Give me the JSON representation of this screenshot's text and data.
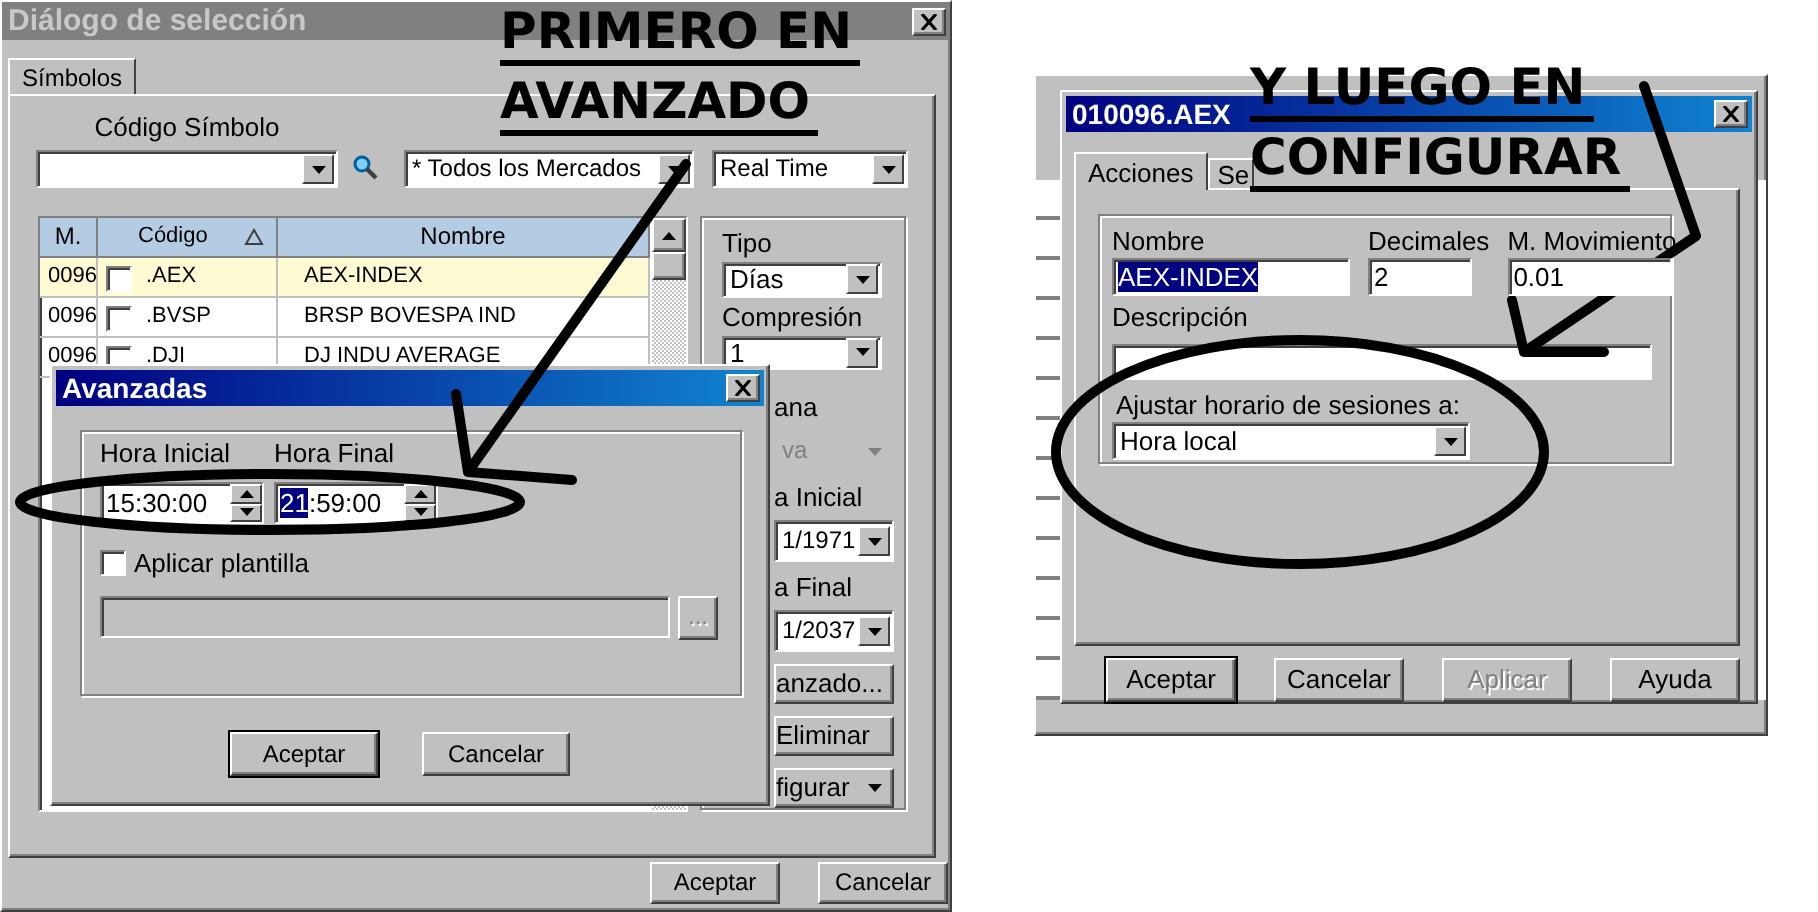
{
  "left_window": {
    "title": "Diálogo de selección",
    "tabs": [
      {
        "label": "Símbolos",
        "selected": true
      }
    ],
    "filters": [
      {
        "label": "Código Símbolo"
      },
      {
        "value": "* Todos los Mercados"
      },
      {
        "value": "Real Time"
      }
    ],
    "table": {
      "columns": [
        "M.",
        "Código",
        "Nombre"
      ],
      "rows": [
        {
          "cells": [
            "0096",
            ".AEX",
            "AEX-INDEX"
          ],
          "selected": true,
          "checked": false
        },
        {
          "cells": [
            "0096",
            ".BVSP",
            "BRSP BOVESPA IND"
          ],
          "selected": false,
          "checked": false
        },
        {
          "cells": [
            "0096",
            ".DJI",
            "DJ INDU AVERAGE"
          ],
          "selected": false,
          "checked": false
        }
      ]
    },
    "side_panel": [
      {
        "kind": "label",
        "text": "Tipo"
      },
      {
        "kind": "combo",
        "text": "Días",
        "disabled": false
      },
      {
        "kind": "label",
        "text": "Compresión"
      },
      {
        "kind": "combo",
        "text": "1",
        "disabled": false
      }
    ],
    "side_panel_partial": [
      {
        "kind": "label",
        "text": "ana"
      },
      {
        "kind": "combo",
        "text": "va",
        "disabled": true
      },
      {
        "kind": "label",
        "text": "a Inicial"
      },
      {
        "kind": "combo",
        "text": "1/1971",
        "disabled": false
      },
      {
        "kind": "label",
        "text": "a Final"
      },
      {
        "kind": "combo",
        "text": "1/2037",
        "disabled": false
      },
      {
        "kind": "button",
        "text": "anzado..."
      },
      {
        "kind": "button",
        "text": "Eliminar"
      },
      {
        "kind": "menu_button",
        "text": "figurar"
      }
    ],
    "buttons": [
      "Aceptar",
      "Cancelar"
    ]
  },
  "advanced_dialog": {
    "title": "Avanzadas",
    "time_fields": [
      {
        "label": "Hora Inicial",
        "value": "15:30:00"
      },
      {
        "label": "Hora Final",
        "selected_text": "21",
        "value": ":59:00"
      }
    ],
    "checkbox": {
      "label": "Aplicar plantilla",
      "checked": false
    },
    "browse_button": "...",
    "buttons": [
      {
        "label": "Aceptar",
        "default": true
      },
      {
        "label": "Cancelar",
        "default": false
      }
    ]
  },
  "config_dialog": {
    "title": "010096.AEX",
    "tabs": [
      {
        "label": "Acciones",
        "selected": true
      },
      {
        "label": "Se",
        "selected": false
      }
    ],
    "fields": [
      {
        "label": "Nombre",
        "value": "AEX-INDEX",
        "selected": true
      },
      {
        "label": "Decimales",
        "value": "2",
        "selected": false
      },
      {
        "label": "M. Movimiento",
        "value": "0.01",
        "selected": false
      }
    ],
    "description": {
      "label": "Descripción"
    },
    "session": {
      "label": "Ajustar horario de sesiones a:",
      "value": "Hora local"
    },
    "buttons": [
      {
        "label": "Aceptar",
        "default": true,
        "disabled": false
      },
      {
        "label": "Cancelar",
        "default": false,
        "disabled": false
      },
      {
        "label": "Aplicar",
        "default": false,
        "disabled": true
      },
      {
        "label": "Ayuda",
        "default": false,
        "disabled": false
      }
    ]
  },
  "annotations": [
    {
      "lines": [
        "PRIMERO EN",
        "AVANZADO"
      ]
    },
    {
      "lines": [
        "Y LUEGO EN",
        "CONFIGURAR"
      ]
    }
  ]
}
